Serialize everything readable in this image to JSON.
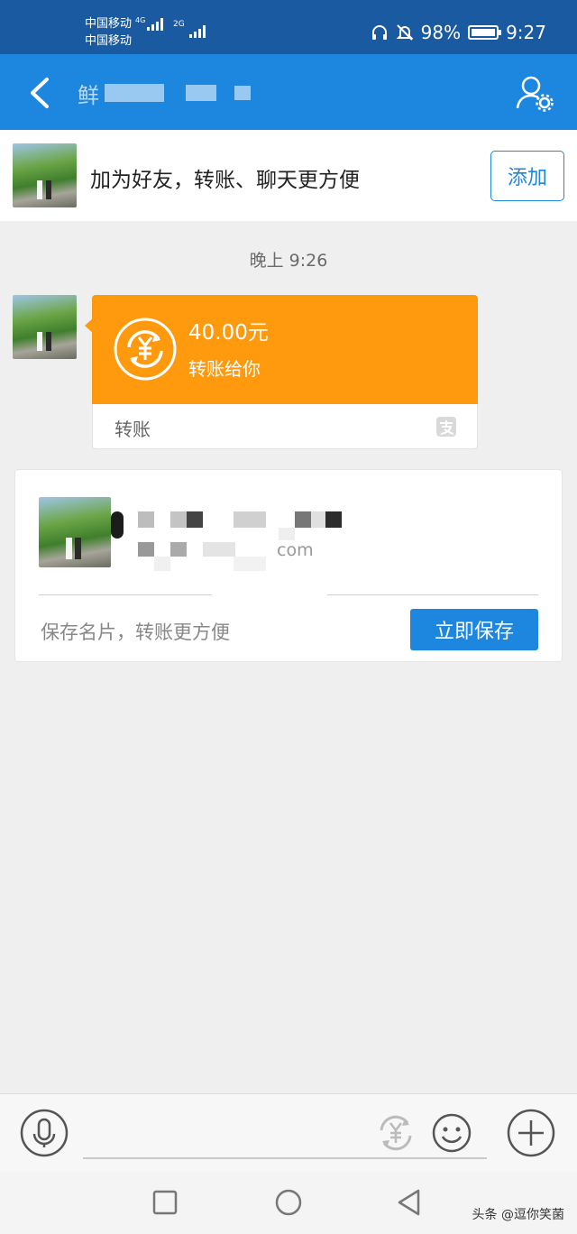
{
  "status_bar": {
    "carrier_1": "中国移动",
    "carrier_1_network": "4G",
    "carrier_2": "中国移动",
    "carrier_2_network": "2G",
    "battery": "98%",
    "time": "9:27"
  },
  "title_bar": {
    "title": "鲜"
  },
  "add_friend_banner": {
    "text": "加为好友，转账、聊天更方便",
    "button": "添加"
  },
  "chat": {
    "timestamp": "晚上 9:26",
    "transfer": {
      "amount": "40.00元",
      "description": "转账给你",
      "label": "转账"
    }
  },
  "card": {
    "email_fragment": "com",
    "hint": "保存名片，转账更方便",
    "button": "立即保存"
  },
  "watermark": "头条 @逗你笑菌",
  "colors": {
    "primary": "#1d87df",
    "status_bar": "#1a5aa0",
    "transfer_orange": "#ff9a0e",
    "background": "#efefef"
  },
  "icons": {
    "back": "chevron-left-icon",
    "settings": "user-settings-icon",
    "transfer": "yuan-exchange-icon",
    "voice": "microphone-icon",
    "emoji": "smile-icon",
    "more": "plus-icon"
  }
}
